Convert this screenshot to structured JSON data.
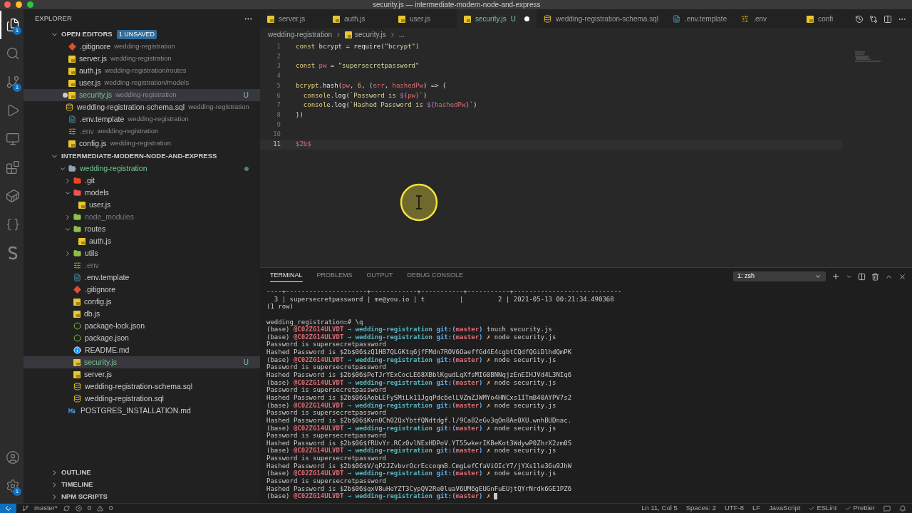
{
  "window": {
    "title": "security.js — intermediate-modern-node-and-express"
  },
  "activity_bar": [
    {
      "kind": "files",
      "selected": true,
      "badge": "1"
    },
    {
      "kind": "search",
      "selected": false
    },
    {
      "kind": "scm",
      "selected": false,
      "badge": "1"
    },
    {
      "kind": "run",
      "selected": false
    },
    {
      "kind": "remote",
      "selected": false
    },
    {
      "kind": "extensions",
      "selected": false
    },
    {
      "kind": "docker",
      "selected": false
    },
    {
      "kind": "json",
      "selected": false
    },
    {
      "kind": "snippet",
      "selected": false
    }
  ],
  "activity_bottom": [
    {
      "kind": "account"
    },
    {
      "kind": "settings",
      "badge": "1"
    }
  ],
  "sidebar": {
    "title": "EXPLORER",
    "open_editors": {
      "title": "OPEN EDITORS",
      "badge": "1 UNSAVED",
      "expanded": true,
      "items": [
        {
          "name": ".gitignore",
          "path": "wedding-registration",
          "kind": "git",
          "untracked": false,
          "ignored": false,
          "selected": false,
          "dirty": false
        },
        {
          "name": "server.js",
          "path": "wedding-registration",
          "kind": "js",
          "untracked": false,
          "ignored": false,
          "selected": false,
          "dirty": false
        },
        {
          "name": "auth.js",
          "path": "wedding-registration/routes",
          "kind": "js",
          "untracked": false,
          "ignored": false,
          "selected": false,
          "dirty": false
        },
        {
          "name": "user.js",
          "path": "wedding-registration/models",
          "kind": "js",
          "untracked": false,
          "ignored": false,
          "selected": false,
          "dirty": false
        },
        {
          "name": "security.js",
          "path": "wedding-registration",
          "kind": "js",
          "untracked": true,
          "ignored": false,
          "selected": true,
          "dirty": true,
          "badge": "U"
        },
        {
          "name": "wedding-registration-schema.sql",
          "path": "wedding-registration",
          "kind": "sql",
          "untracked": false,
          "ignored": false,
          "selected": false,
          "dirty": false
        },
        {
          "name": ".env.template",
          "path": "wedding-registration",
          "kind": "doc",
          "untracked": false,
          "ignored": false,
          "selected": false,
          "dirty": false
        },
        {
          "name": ".env",
          "path": "wedding-registration",
          "kind": "env",
          "untracked": false,
          "ignored": true,
          "selected": false,
          "dirty": false
        },
        {
          "name": "config.js",
          "path": "wedding-registration",
          "kind": "js",
          "untracked": false,
          "ignored": false,
          "selected": false,
          "dirty": false
        }
      ]
    },
    "workspace": {
      "title": "INTERMEDIATE-MODERN-NODE-AND-EXPRESS",
      "expanded": true,
      "items": [
        {
          "label": "wedding-registration",
          "kind": "folder",
          "untracked": true,
          "ignored": false,
          "selected": false,
          "expanded": true,
          "dot": true,
          "children": [
            {
              "label": ".git",
              "kind": "folder-git",
              "untracked": false,
              "ignored": false,
              "selected": false,
              "expanded": false
            },
            {
              "label": "models",
              "kind": "folder-models",
              "untracked": false,
              "ignored": false,
              "selected": false,
              "expanded": true,
              "children": [
                {
                  "label": "user.js",
                  "kind": "js",
                  "untracked": false,
                  "ignored": false,
                  "selected": false
                }
              ]
            },
            {
              "label": "node_modules",
              "kind": "folder-node",
              "untracked": false,
              "ignored": true,
              "selected": false,
              "expanded": false
            },
            {
              "label": "routes",
              "kind": "folder-routes",
              "untracked": false,
              "ignored": false,
              "selected": false,
              "expanded": true,
              "children": [
                {
                  "label": "auth.js",
                  "kind": "js",
                  "untracked": false,
                  "ignored": false,
                  "selected": false
                }
              ]
            },
            {
              "label": "utils",
              "kind": "folder-node",
              "untracked": false,
              "ignored": false,
              "selected": false,
              "expanded": false
            },
            {
              "label": ".env",
              "kind": "env",
              "untracked": false,
              "ignored": true,
              "selected": false
            },
            {
              "label": ".env.template",
              "kind": "doc",
              "untracked": false,
              "ignored": false,
              "selected": false
            },
            {
              "label": ".gitignore",
              "kind": "git",
              "untracked": false,
              "ignored": false,
              "selected": false
            },
            {
              "label": "config.js",
              "kind": "js",
              "untracked": false,
              "ignored": false,
              "selected": false
            },
            {
              "label": "db.js",
              "kind": "js",
              "untracked": false,
              "ignored": false,
              "selected": false
            },
            {
              "label": "package-lock.json",
              "kind": "npm",
              "untracked": false,
              "ignored": false,
              "selected": false
            },
            {
              "label": "package.json",
              "kind": "npm",
              "untracked": false,
              "ignored": false,
              "selected": false
            },
            {
              "label": "README.md",
              "kind": "info",
              "untracked": false,
              "ignored": false,
              "selected": false
            },
            {
              "label": "security.js",
              "kind": "js",
              "untracked": true,
              "ignored": false,
              "selected": true,
              "badge": "U"
            },
            {
              "label": "server.js",
              "kind": "js",
              "untracked": false,
              "ignored": false,
              "selected": false
            },
            {
              "label": "wedding-registration-schema.sql",
              "kind": "sql",
              "untracked": false,
              "ignored": false,
              "selected": false
            },
            {
              "label": "wedding-registration.sql",
              "kind": "sql",
              "untracked": false,
              "ignored": false,
              "selected": false
            }
          ]
        },
        {
          "label": "POSTGRES_INSTALLATION.md",
          "kind": "md",
          "untracked": false,
          "ignored": false,
          "selected": false
        }
      ]
    },
    "sections": [
      {
        "title": "OUTLINE",
        "expanded": false
      },
      {
        "title": "TIMELINE",
        "expanded": false
      },
      {
        "title": "NPM SCRIPTS",
        "expanded": false
      }
    ]
  },
  "tabs": [
    {
      "label": "server.js",
      "kind": "js",
      "selected": false,
      "dirty": false
    },
    {
      "label": "auth.js",
      "kind": "js",
      "selected": false,
      "dirty": false
    },
    {
      "label": "user.js",
      "kind": "js",
      "selected": false,
      "dirty": false
    },
    {
      "label": "security.js",
      "kind": "js",
      "selected": true,
      "dirty": true,
      "badge": "U"
    },
    {
      "label": "wedding-registration-schema.sql",
      "kind": "sql",
      "selected": false,
      "dirty": false
    },
    {
      "label": ".env.template",
      "kind": "doc",
      "selected": false,
      "dirty": false
    },
    {
      "label": ".env",
      "kind": "env",
      "selected": false,
      "dirty": false
    },
    {
      "label": "confi",
      "kind": "js",
      "selected": false,
      "dirty": false
    }
  ],
  "breadcrumbs": [
    {
      "label": "wedding-registration",
      "kind": "folder"
    },
    {
      "label": "security.js",
      "kind": "js"
    },
    {
      "label": "...",
      "kind": "symbol"
    }
  ],
  "editor": {
    "lines": [
      {
        "number": "1",
        "current": false,
        "tokens": [
          {
            "kind": "keyword",
            "text": "const "
          },
          {
            "kind": "plain",
            "text": "bcrypt = "
          },
          {
            "kind": "func",
            "text": "require"
          },
          {
            "kind": "plain",
            "text": "("
          },
          {
            "kind": "string",
            "text": "\"bcrypt\""
          },
          {
            "kind": "plain",
            "text": ")"
          }
        ]
      },
      {
        "number": "2",
        "current": false
      },
      {
        "number": "3",
        "current": false,
        "tokens": [
          {
            "kind": "keyword",
            "text": "const "
          },
          {
            "kind": "variable",
            "text": "pw"
          },
          {
            "kind": "plain",
            "text": " = "
          },
          {
            "kind": "string",
            "text": "\"supersecretpassword\""
          }
        ]
      },
      {
        "number": "4",
        "current": false
      },
      {
        "number": "5",
        "current": false,
        "tokens": [
          {
            "kind": "keyword",
            "text": "bcrypt"
          },
          {
            "kind": "plain",
            "text": "."
          },
          {
            "kind": "func",
            "text": "hash"
          },
          {
            "kind": "plain",
            "text": "("
          },
          {
            "kind": "variable",
            "text": "pw"
          },
          {
            "kind": "plain",
            "text": ", "
          },
          {
            "kind": "number",
            "text": "6"
          },
          {
            "kind": "plain",
            "text": ", ("
          },
          {
            "kind": "variable",
            "text": "err"
          },
          {
            "kind": "plain",
            "text": ", "
          },
          {
            "kind": "variable",
            "text": "hashedPw"
          },
          {
            "kind": "plain",
            "text": ") => {"
          }
        ]
      },
      {
        "number": "6",
        "current": false,
        "tokens": [
          {
            "kind": "keyword",
            "text": "  console"
          },
          {
            "kind": "plain",
            "text": "."
          },
          {
            "kind": "func",
            "text": "log"
          },
          {
            "kind": "plain",
            "text": "("
          },
          {
            "kind": "string",
            "text": "`Password is "
          },
          {
            "kind": "interp",
            "text": "${"
          },
          {
            "kind": "variable",
            "text": "pw"
          },
          {
            "kind": "interp",
            "text": "}"
          },
          {
            "kind": "string",
            "text": "`"
          },
          {
            "kind": "plain",
            "text": ")"
          }
        ]
      },
      {
        "number": "7",
        "current": false,
        "tokens": [
          {
            "kind": "keyword",
            "text": "  console"
          },
          {
            "kind": "plain",
            "text": "."
          },
          {
            "kind": "func",
            "text": "log"
          },
          {
            "kind": "plain",
            "text": "("
          },
          {
            "kind": "string",
            "text": "`Hashed Password is "
          },
          {
            "kind": "interp",
            "text": "${"
          },
          {
            "kind": "variable",
            "text": "hashedPw"
          },
          {
            "kind": "interp",
            "text": "}"
          },
          {
            "kind": "string",
            "text": "`"
          },
          {
            "kind": "plain",
            "text": ")"
          }
        ]
      },
      {
        "number": "8",
        "current": false,
        "tokens": [
          {
            "kind": "plain",
            "text": "})"
          }
        ]
      },
      {
        "number": "9",
        "current": false
      },
      {
        "number": "10",
        "current": false
      },
      {
        "number": "11",
        "current": true,
        "tokens": [
          {
            "kind": "variable",
            "text": "$2b$"
          }
        ]
      }
    ]
  },
  "panel": {
    "tabs": [
      {
        "label": "TERMINAL",
        "selected": true
      },
      {
        "label": "PROBLEMS",
        "selected": false
      },
      {
        "label": "OUTPUT",
        "selected": false
      },
      {
        "label": "DEBUG CONSOLE",
        "selected": false
      }
    ],
    "terminal_select": "1: zsh",
    "lines": [
      {
        "kind": "plain",
        "text": "----+---------------------+------------+-----------+-----------+----------------------------"
      },
      {
        "kind": "plain",
        "text": "  3 | supersecretpassword | me@you.io | t         |         2 | 2021-05-13 00:21:34.490368"
      },
      {
        "kind": "plain",
        "text": "(1 row)"
      },
      {
        "kind": "blank"
      },
      {
        "kind": "plain",
        "text": "wedding_registration=# \\q"
      },
      {
        "kind": "prompt",
        "base": "(base)",
        "host": "@C02ZG14ULVDT",
        "arrow": "→",
        "dir": "wedding-registration",
        "git": "git:(",
        "branch": "master",
        "git_close": ")",
        "dirty": false,
        "command": "touch security.js"
      },
      {
        "kind": "prompt",
        "base": "(base)",
        "host": "@C02ZG14ULVDT",
        "arrow": "→",
        "dir": "wedding-registration",
        "git": "git:(",
        "branch": "master",
        "git_close": ")",
        "dirty": true,
        "dirty_mark": "✗",
        "command": "node security.js"
      },
      {
        "kind": "plain",
        "text": "Password is supersecretpassword"
      },
      {
        "kind": "plain",
        "text": "Hashed Password is $2b$06$zQ1HB7QLGKtq6jfFMdn7ROV6OaeffGd4E4cgbtCQdfQGiDlhdQmPK"
      },
      {
        "kind": "prompt",
        "base": "(base)",
        "host": "@C02ZG14ULVDT",
        "arrow": "→",
        "dir": "wedding-registration",
        "git": "git:(",
        "branch": "master",
        "git_close": ")",
        "dirty": true,
        "dirty_mark": "✗",
        "command": "node security.js"
      },
      {
        "kind": "plain",
        "text": "Password is supersecretpassword"
      },
      {
        "kind": "plain",
        "text": "Hashed Password is $2b$06$PeTJrYExCocLE68XBblKgudLqXfsMIG0BNNqjzEnEIHJVd4L3NIq6"
      },
      {
        "kind": "prompt",
        "base": "(base)",
        "host": "@C02ZG14ULVDT",
        "arrow": "→",
        "dir": "wedding-registration",
        "git": "git:(",
        "branch": "master",
        "git_close": ")",
        "dirty": true,
        "dirty_mark": "✗",
        "command": "node security.js"
      },
      {
        "kind": "plain",
        "text": "Password is supersecretpassword"
      },
      {
        "kind": "plain",
        "text": "Hashed Password is $2b$06$AobLEFySMiLk11JgqPdc6elLVZmZJWMYo4HNCxs1ITmB40AYPV7s2"
      },
      {
        "kind": "prompt",
        "base": "(base)",
        "host": "@C02ZG14ULVDT",
        "arrow": "→",
        "dir": "wedding-registration",
        "git": "git:(",
        "branch": "master",
        "git_close": ")",
        "dirty": true,
        "dirty_mark": "✗",
        "command": "node security.js"
      },
      {
        "kind": "plain",
        "text": "Password is supersecretpassword"
      },
      {
        "kind": "plain",
        "text": "Hashed Password is $2b$06$Kvn0Ch02QxYbtfQNdtdgf.l/9Ca82eGv3qOn8Ae0XU.wnhBUDnac."
      },
      {
        "kind": "prompt",
        "base": "(base)",
        "host": "@C02ZG14ULVDT",
        "arrow": "→",
        "dir": "wedding-registration",
        "git": "git:(",
        "branch": "master",
        "git_close": ")",
        "dirty": true,
        "dirty_mark": "✗",
        "command": "node security.js"
      },
      {
        "kind": "plain",
        "text": "Password is supersecretpassword"
      },
      {
        "kind": "plain",
        "text": "Hashed Password is $2b$06$fRUvYr.RCz0vlNExHDPoV.YT55wkerIKBeKot3WdywP0ZhrX2zm0S"
      },
      {
        "kind": "prompt",
        "base": "(base)",
        "host": "@C02ZG14ULVDT",
        "arrow": "→",
        "dir": "wedding-registration",
        "git": "git:(",
        "branch": "master",
        "git_close": ")",
        "dirty": true,
        "dirty_mark": "✗",
        "command": "node security.js"
      },
      {
        "kind": "plain",
        "text": "Password is supersecretpassword"
      },
      {
        "kind": "plain",
        "text": "Hashed Password is $2b$06$V/qP2JZvbvrOcrEccoqmB.CmgLefCfaViOIcY7/jYXs1le36u9JhW"
      },
      {
        "kind": "prompt",
        "base": "(base)",
        "host": "@C02ZG14ULVDT",
        "arrow": "→",
        "dir": "wedding-registration",
        "git": "git:(",
        "branch": "master",
        "git_close": ")",
        "dirty": true,
        "dirty_mark": "✗",
        "command": "node security.js"
      },
      {
        "kind": "plain",
        "text": "Password is supersecretpassword"
      },
      {
        "kind": "plain",
        "text": "Hashed Password is $2b$06$qxV8uHeYZT3CypQV2Re0luaV6UM6gEUGnFuEUjtQYrNrdk6GE1PZ6"
      },
      {
        "kind": "prompt",
        "base": "(base)",
        "host": "@C02ZG14ULVDT",
        "arrow": "→",
        "dir": "wedding-registration",
        "git": "git:(",
        "branch": "master",
        "git_close": ")",
        "dirty": true,
        "dirty_mark": "✗",
        "cursor": true
      }
    ]
  },
  "status_bar": {
    "branch": "master*",
    "errors": "0",
    "warnings": "0",
    "right": [
      {
        "kind": "text",
        "label": "Ln 11, Col 5"
      },
      {
        "kind": "text",
        "label": "Spaces: 2"
      },
      {
        "kind": "text",
        "label": "UTF-8"
      },
      {
        "kind": "text",
        "label": "LF"
      },
      {
        "kind": "text",
        "label": "JavaScript"
      },
      {
        "kind": "check",
        "label": "ESLint"
      },
      {
        "kind": "check",
        "label": "Prettier"
      },
      {
        "kind": "feedback"
      },
      {
        "kind": "bell"
      }
    ]
  }
}
